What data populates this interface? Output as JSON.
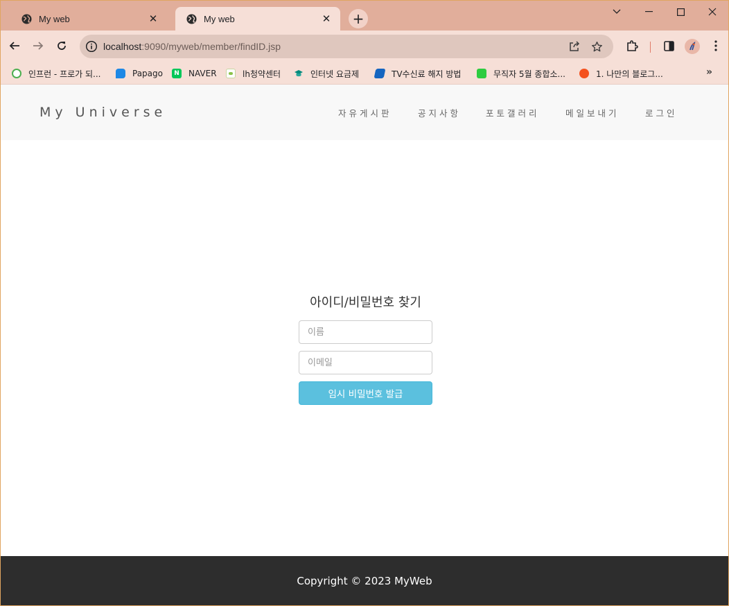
{
  "browser": {
    "tabs": [
      {
        "title": "My web",
        "active": false
      },
      {
        "title": "My web",
        "active": true
      }
    ],
    "new_tab_label": "+",
    "url_host": "localhost",
    "url_rest": ":9090/myweb/member/findID.jsp",
    "bookmarks": [
      {
        "label": "인프런 - 프로가 되...",
        "icon": "inflearn-icon",
        "color": "#4caf50"
      },
      {
        "label": "Papago",
        "icon": "papago-icon",
        "color": "#1e88e5"
      },
      {
        "label": "NAVER",
        "icon": "naver-icon",
        "color": "#03c75a"
      },
      {
        "label": "lh청약센터",
        "icon": "lh-icon",
        "color": "#8bc34a"
      },
      {
        "label": "인터넷 요금제",
        "icon": "graduation-icon",
        "color": "#00897b"
      },
      {
        "label": "TV수신료 해지 방법",
        "icon": "kbs-icon",
        "color": "#1565c0"
      },
      {
        "label": "무직자 5월 종합소...",
        "icon": "chat-icon",
        "color": "#2ecc40"
      },
      {
        "label": "1. 나만의 블로그...",
        "icon": "tistory-icon",
        "color": "#f4511e"
      }
    ],
    "more_label": "»"
  },
  "site": {
    "brand": "My Universe",
    "nav": [
      "자유게시판",
      "공지사항",
      "포토갤러리",
      "메일보내기",
      "로그인"
    ]
  },
  "form": {
    "title": "아이디/비밀번호 찾기",
    "name_placeholder": "이름",
    "email_placeholder": "이메일",
    "submit_label": "임시 비밀번호 발급"
  },
  "footer": {
    "text": "Copyright © 2023 MyWeb"
  },
  "colors": {
    "tabstrip": "#e1ae9b",
    "toolbar": "#f6dfd7",
    "button": "#5bc0de",
    "footer": "#2d2d2d"
  }
}
